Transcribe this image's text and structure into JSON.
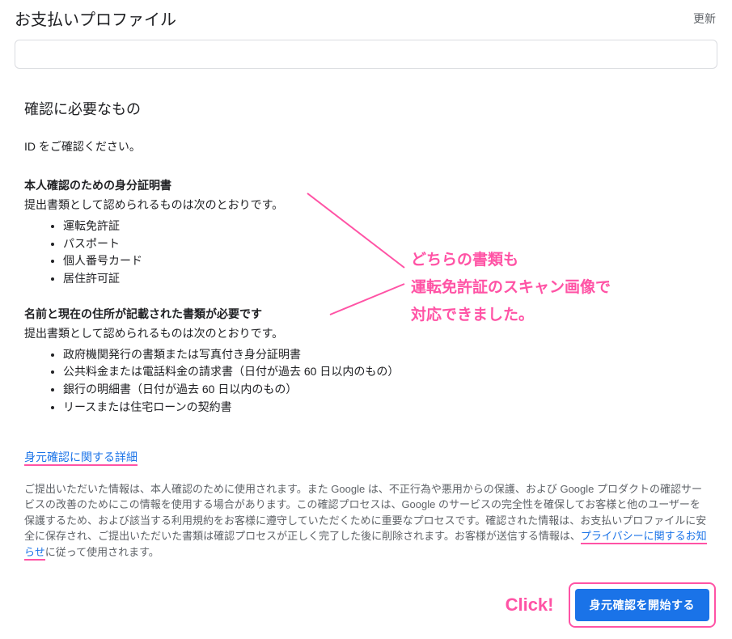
{
  "header": {
    "title": "お支払いプロファイル",
    "update": "更新"
  },
  "section": {
    "title": "確認に必要なもの",
    "instruction": "ID をご確認ください。"
  },
  "idDocs": {
    "title": "本人確認のための身分証明書",
    "desc": "提出書類として認められるものは次のとおりです。",
    "items": [
      "運転免許証",
      "パスポート",
      "個人番号カード",
      "居住許可証"
    ]
  },
  "addressDocs": {
    "title": "名前と現在の住所が記載された書類が必要です",
    "desc": "提出書類として認められるものは次のとおりです。",
    "items": [
      "政府機関発行の書類または写真付き身分証明書",
      "公共料金または電話料金の請求書（日付が過去 60 日以内のもの）",
      "銀行の明細書（日付が過去 60 日以内のもの）",
      "リースまたは住宅ローンの契約書"
    ]
  },
  "detailsLink": "身元確認に関する詳細",
  "disclaimer": {
    "part1": "ご提出いただいた情報は、本人確認のために使用されます。また Google は、不正行為や悪用からの保護、および Google プロダクトの確認サービスの改善のためにこの情報を使用する場合があります。この確認プロセスは、Google のサービスの完全性を確保してお客様と他のユーザーを保護するため、および該当する利用規約をお客様に遵守していただくために重要なプロセスです。確認された情報は、お支払いプロファイルに安全に保存され、ご提出いただいた書類は確認プロセスが正しく完了した後に削除されます。お客様が送信する情報は、",
    "privacyLink": "プライバシーに関するお知らせ",
    "part2": "に従って使用されます。"
  },
  "annotation": {
    "line1": "どちらの書類も",
    "line2": "運転免許証のスキャン画像で",
    "line3": "対応できました。",
    "click": "Click!"
  },
  "button": {
    "start": "身元確認を開始する"
  }
}
